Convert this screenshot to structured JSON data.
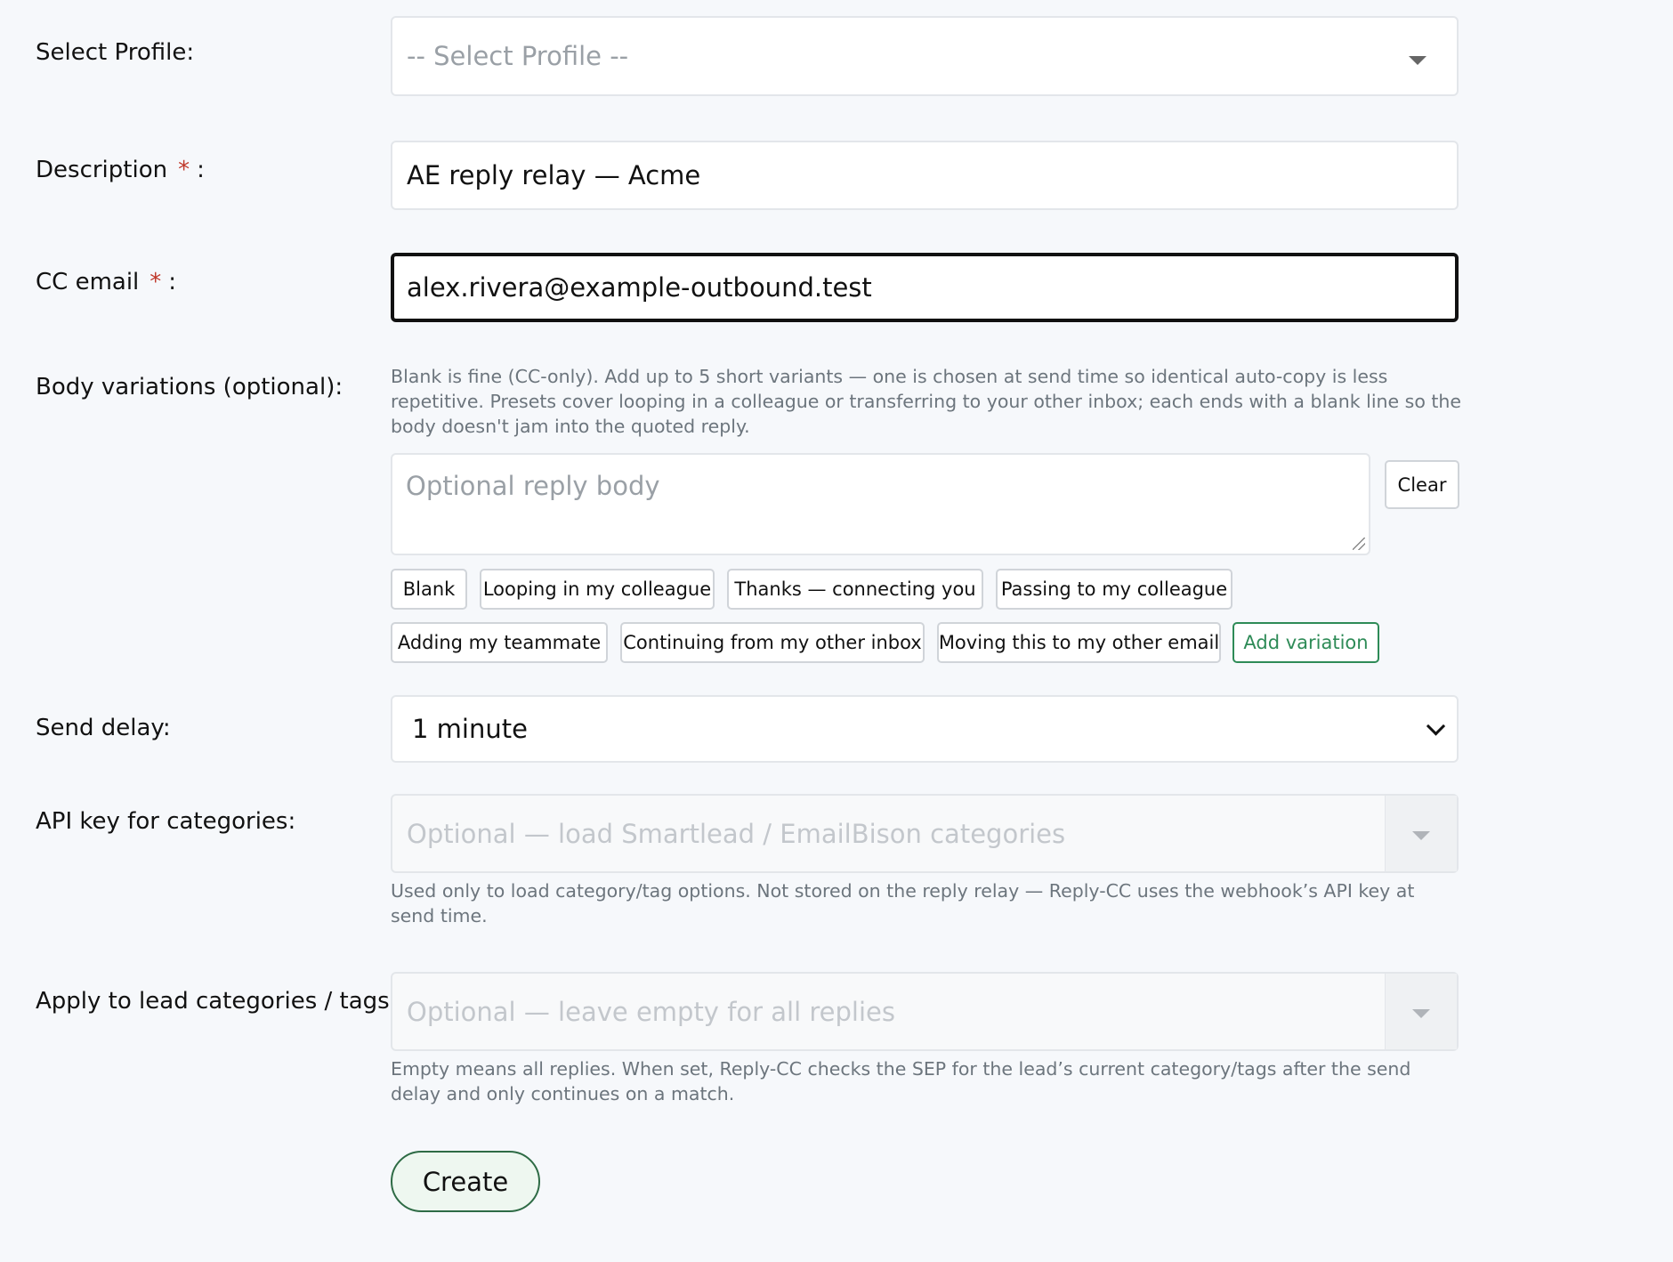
{
  "profile": {
    "label": "Select Profile:",
    "placeholder": "-- Select Profile --"
  },
  "description": {
    "label": "Description",
    "required_mark": "*",
    "colon": ":",
    "value": "AE reply relay — Acme"
  },
  "cc_email": {
    "label": "CC email",
    "required_mark": "*",
    "colon": ":",
    "value": "alex.rivera@example-outbound.test"
  },
  "body_variations": {
    "label": "Body variations (optional):",
    "help": "Blank is fine (CC-only). Add up to 5 short variants — one is chosen at send time so identical auto-copy is less repetitive. Presets cover looping in a colleague or transferring to your other inbox; each ends with a blank line so the body doesn't jam into the quoted reply.",
    "textarea_placeholder": "Optional reply body",
    "clear_label": "Clear",
    "presets": [
      "Blank",
      "Looping in my colleague",
      "Thanks — connecting you",
      "Passing to my colleague",
      "Adding my teammate",
      "Continuing from my other inbox",
      "Moving this to my other email"
    ],
    "add_label": "Add variation"
  },
  "send_delay": {
    "label": "Send delay:",
    "value": "1 minute"
  },
  "api_key": {
    "label": "API key for categories:",
    "placeholder": "Optional — load Smartlead / EmailBison categories",
    "help": "Used only to load category/tag options. Not stored on the reply relay — Reply-CC uses the webhook’s API key at send time."
  },
  "categories": {
    "label": "Apply to lead categories / tags:",
    "placeholder": "Optional — leave empty for all replies",
    "help": "Empty means all replies. When set, Reply-CC checks the SEP for the lead’s current category/tags after the send delay and only continues on a match."
  },
  "create_label": "Create",
  "colors": {
    "accent_green": "#2e8b57",
    "required_red": "#c0392b",
    "page_bg": "#f6f8fb"
  }
}
